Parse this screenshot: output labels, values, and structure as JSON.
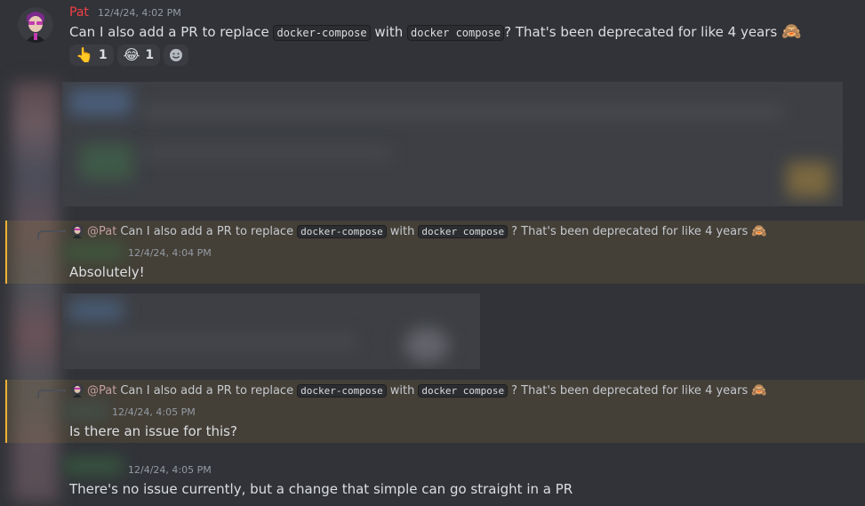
{
  "messages": [
    {
      "author": "Pat",
      "author_color": "#f23f43",
      "timestamp": "12/4/24, 4:02 PM",
      "text_before": "Can I also add a PR to replace ",
      "code1": "docker-compose",
      "text_mid": " with ",
      "code2": "docker compose",
      "text_after": "? That's been deprecated for like 4 years",
      "emoji": "🙈",
      "reactions": [
        {
          "emoji": "👆",
          "count": "1"
        },
        {
          "emoji": "😂",
          "count": "1"
        }
      ]
    },
    {
      "reply": {
        "mention": "@Pat",
        "text_before": "Can I also add a PR to replace",
        "code1": "docker-compose",
        "text_mid": "with",
        "code2": "docker compose",
        "text_after": "? That's been deprecated for like 4 years",
        "emoji": "🙈"
      },
      "timestamp": "12/4/24, 4:04 PM",
      "text": "Absolutely!"
    },
    {
      "reply": {
        "mention": "@Pat",
        "text_before": "Can I also add a PR to replace",
        "code1": "docker-compose",
        "text_mid": "with",
        "code2": "docker compose",
        "text_after": "? That's been deprecated for like 4 years",
        "emoji": "🙈"
      },
      "timestamp": "12/4/24, 4:05 PM",
      "text": "Is there an issue for this?"
    },
    {
      "timestamp": "12/4/24, 4:05 PM",
      "text": "There's no issue currently, but a change that simple can go straight in a PR"
    }
  ],
  "colors": {
    "background": "#313338",
    "mention_highlight": "#f0b232"
  }
}
